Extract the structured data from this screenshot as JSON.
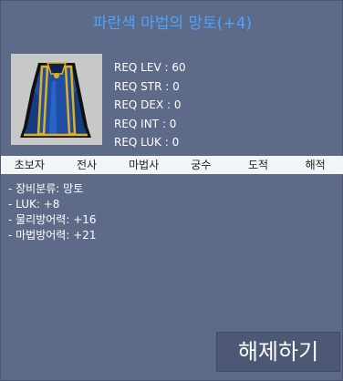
{
  "item": {
    "title": "파란색 마법의 망토(+4)",
    "icon": "blue-cape-icon"
  },
  "requirements": [
    "REQ LEV : 60",
    "REQ STR : 0",
    "REQ DEX : 0",
    "REQ INT : 0",
    "REQ LUK : 0"
  ],
  "jobs": [
    "초보자",
    "전사",
    "마법사",
    "궁수",
    "도적",
    "해적"
  ],
  "stats": [
    "- 장비분류: 망토",
    "- LUK: +8",
    "- 물리방어력: +16",
    "- 마법방어력: +21"
  ],
  "release_button": "해제하기",
  "colors": {
    "background": "#5d6a88",
    "title": "#4da3ff",
    "job_bar": "#f2f4f5",
    "button": "#4c5874"
  }
}
